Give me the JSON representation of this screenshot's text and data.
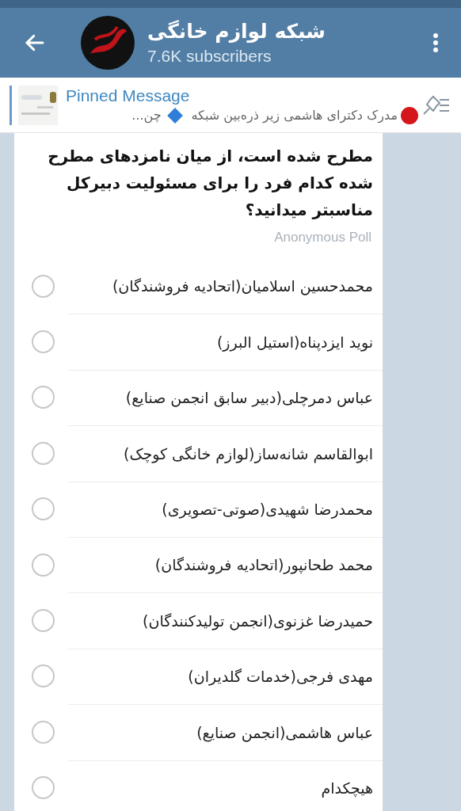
{
  "header": {
    "title": "شبکه لوازم خانگی",
    "subtitle": "7.6K subscribers"
  },
  "pinned": {
    "label": "Pinned Message",
    "text": "مدرک دکترای هاشمی زیر ذره‌بین شبکه",
    "text_2": "چن..."
  },
  "poll": {
    "question": "مطرح شده است، از میان نامزدهای مطرح شده کدام فرد را برای مسئولیت دبیرکل مناسبتر میدانید؟",
    "type_label": "Anonymous Poll",
    "options": [
      {
        "label": "محمدحسین اسلامیان(اتحادیه فروشندگان)",
        "selected": false
      },
      {
        "label": "نوید ایزدپناه(استیل البرز)",
        "selected": false
      },
      {
        "label": "عباس دمرچلی(دبیر سابق انجمن صنایع)",
        "selected": false
      },
      {
        "label": "ابوالقاسم شانه‌ساز(لوازم خانگی کوچک)",
        "selected": false
      },
      {
        "label": "محمدرضا شهیدی(صوتی-تصویری)",
        "selected": false
      },
      {
        "label": "محمد طحانپور(اتحادیه فروشندگان)",
        "selected": false
      },
      {
        "label": "حمیدرضا غزنوی(انجمن تولیدکنندگان)",
        "selected": false
      },
      {
        "label": "مهدی فرجی(خدمات گلدیران)",
        "selected": false
      },
      {
        "label": "عباس هاشمی(انجمن صنایع)",
        "selected": false
      },
      {
        "label": "هیچکدام",
        "selected": false
      }
    ]
  }
}
